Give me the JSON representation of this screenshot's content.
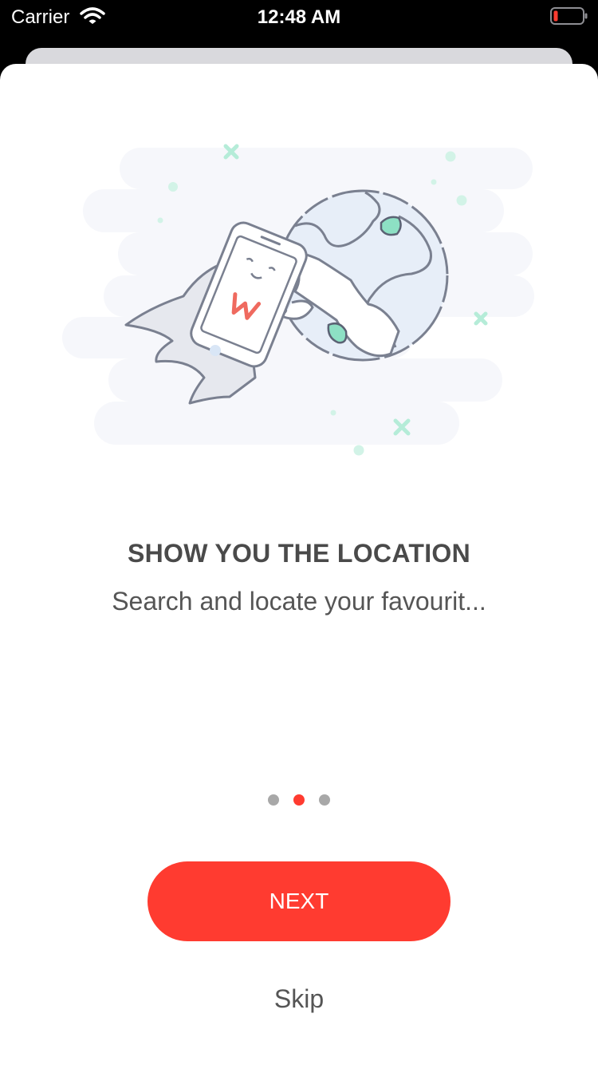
{
  "status_bar": {
    "carrier": "Carrier",
    "time": "12:48 AM",
    "wifi_icon": "wifi-icon",
    "battery_icon": "battery-low-icon"
  },
  "onboarding": {
    "illustration": "rocket-phone-globe-illustration",
    "title": "SHOW YOU THE LOCATION",
    "subtitle": "Search and locate your favourit...",
    "page_indicator": {
      "total": 3,
      "current": 2
    },
    "next_label": "NEXT",
    "skip_label": "Skip"
  },
  "colors": {
    "accent": "#ff3b30",
    "dot_inactive": "#a8a8a8",
    "text": "#4a4a4a",
    "illustration_mint": "#8de0c4",
    "illustration_line": "#7a8090"
  }
}
